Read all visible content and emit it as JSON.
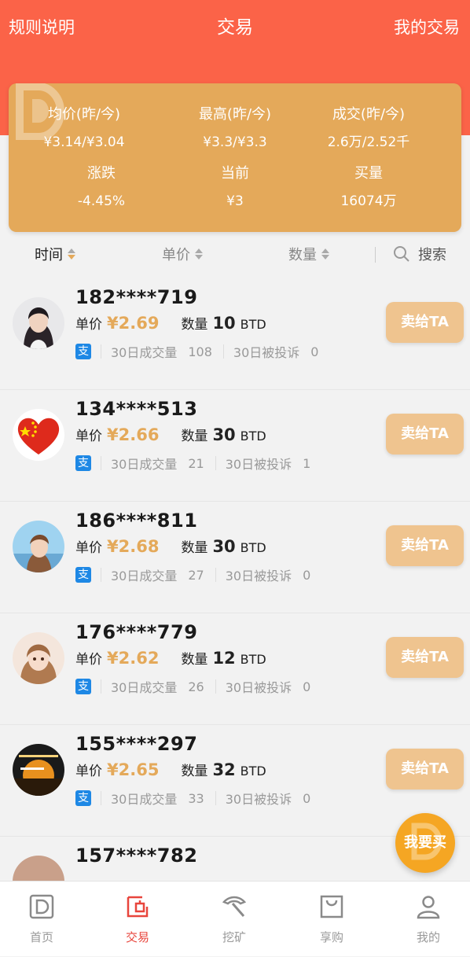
{
  "header": {
    "left": "规则说明",
    "title": "交易",
    "right": "我的交易"
  },
  "stats": [
    {
      "label": "均价(昨/今)",
      "value": "¥3.14/¥3.04"
    },
    {
      "label": "最高(昨/今)",
      "value": "¥3.3/¥3.3"
    },
    {
      "label": "成交(昨/今)",
      "value": "2.6万/2.52千"
    },
    {
      "label": "涨跌",
      "value": "-4.45%"
    },
    {
      "label": "当前",
      "value": "¥3"
    },
    {
      "label": "买量",
      "value": "16074万"
    }
  ],
  "sortbar": {
    "time": "时间",
    "price": "单价",
    "qty": "数量",
    "search": "搜索"
  },
  "labels": {
    "price": "单价",
    "qty": "数量",
    "unit": "BTD",
    "vol30": "30日成交量",
    "complaints30": "30日被投诉",
    "sell": "卖给TA",
    "pay_icon": "支"
  },
  "listings": [
    {
      "phone": "182****719",
      "price": "¥2.69",
      "qty": "10",
      "vol": "108",
      "complaints": "0",
      "avatar": "woman-dark-hair"
    },
    {
      "phone": "134****513",
      "price": "¥2.66",
      "qty": "30",
      "vol": "21",
      "complaints": "1",
      "avatar": "heart-flag"
    },
    {
      "phone": "186****811",
      "price": "¥2.68",
      "qty": "30",
      "vol": "27",
      "complaints": "0",
      "avatar": "girl-sky"
    },
    {
      "phone": "176****779",
      "price": "¥2.62",
      "qty": "12",
      "vol": "26",
      "complaints": "0",
      "avatar": "doll"
    },
    {
      "phone": "155****297",
      "price": "¥2.65",
      "qty": "32",
      "vol": "33",
      "complaints": "0",
      "avatar": "sunset"
    },
    {
      "phone": "157****782",
      "price": "",
      "qty": "",
      "vol": "",
      "complaints": "",
      "avatar": "partial"
    }
  ],
  "fab": "我要买",
  "tabs": [
    {
      "label": "首页",
      "icon": "home-logo-icon"
    },
    {
      "label": "交易",
      "icon": "trade-icon"
    },
    {
      "label": "挖矿",
      "icon": "pickaxe-icon"
    },
    {
      "label": "享购",
      "icon": "shopping-bag-icon"
    },
    {
      "label": "我的",
      "icon": "user-icon"
    }
  ],
  "colors": {
    "header": "#fb6348",
    "card": "#e4a95a",
    "sell_button": "#efc48f",
    "price": "#e4a95a",
    "fab": "#f5a623",
    "tab_active": "#e8453c"
  }
}
